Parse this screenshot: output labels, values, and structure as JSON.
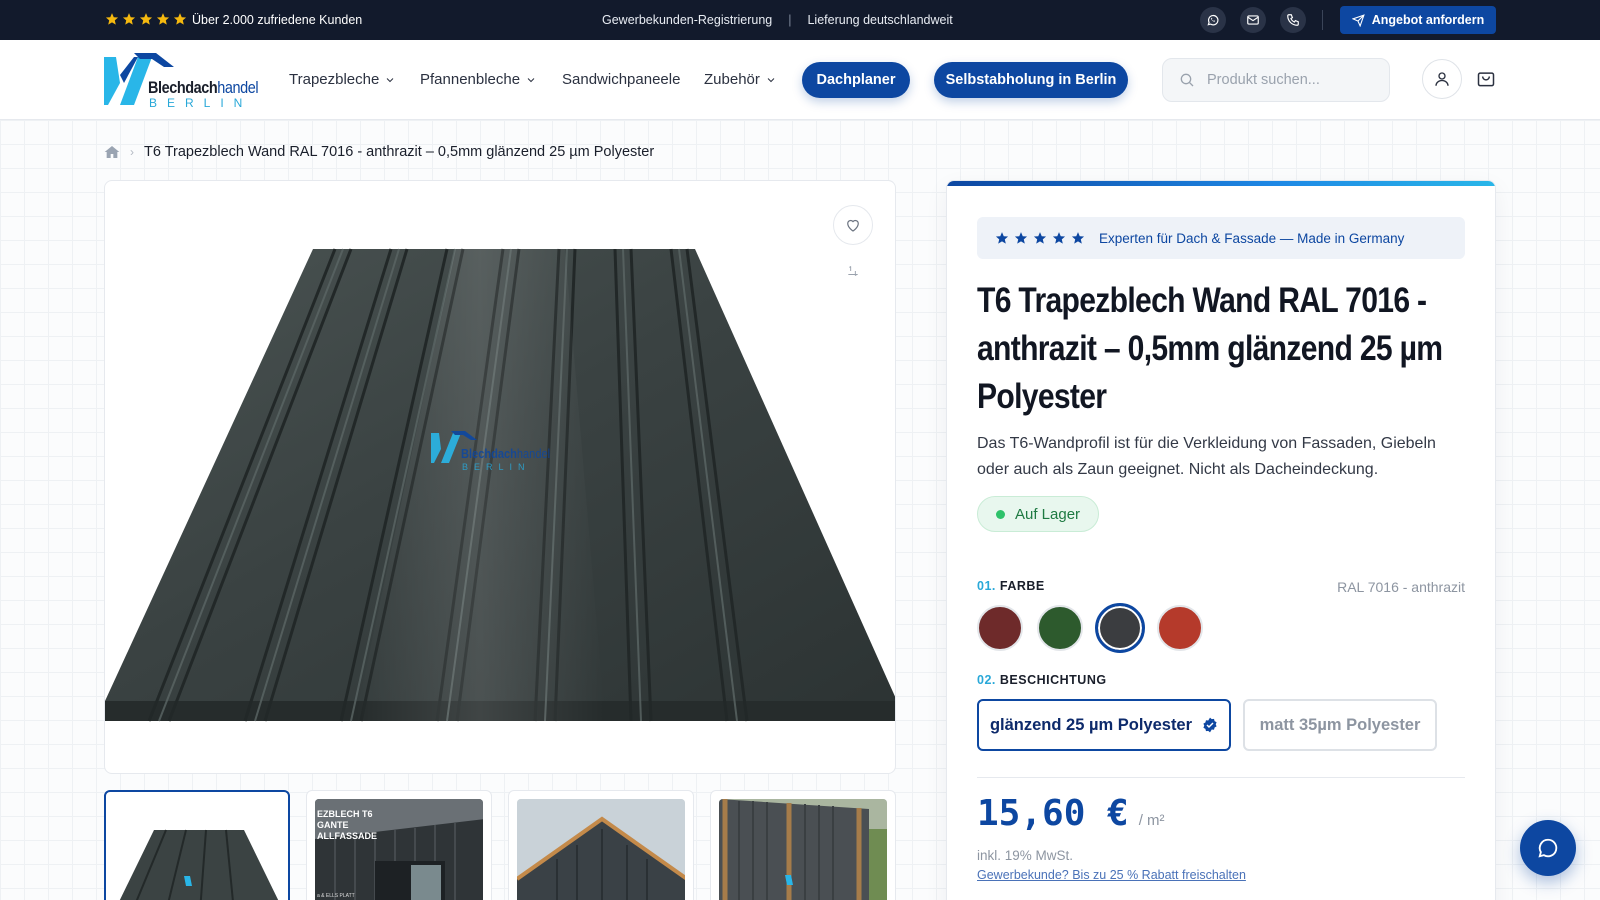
{
  "topbar": {
    "rating_text": "Über 2.000 zufriedene Kunden",
    "link_b2b": "Gewerbekunden-Registrierung",
    "separator": "|",
    "delivery": "Lieferung deutschlandweit",
    "offer_button": "Angebot anfordern",
    "icons": [
      "whatsapp-icon",
      "mail-icon",
      "phone-icon"
    ]
  },
  "header": {
    "logo_main": "Blechdach",
    "logo_accent": "handel",
    "logo_sub": "BERLIN",
    "nav": [
      {
        "label": "Trapezbleche",
        "dropdown": true
      },
      {
        "label": "Pfannenbleche",
        "dropdown": true
      },
      {
        "label": "Sandwichpaneele",
        "dropdown": false
      },
      {
        "label": "Zubehör",
        "dropdown": true
      }
    ],
    "pill_planner": "Dachplaner",
    "pill_pickup": "Selbstabholung in Berlin",
    "search_placeholder": "Produkt suchen..."
  },
  "breadcrumb": {
    "current": "T6 Trapezblech Wand RAL 7016 - anthrazit – 0,5mm glänzend 25 µm Polyester"
  },
  "gallery": {
    "watermark_main": "Blechdach",
    "watermark_accent": "handel",
    "watermark_sub": "BERLIN",
    "thumb2_text": [
      "EZBLECH T6",
      "GANTE",
      "ALLFASSADE"
    ],
    "thumb2_caption": "a & ELLS PLATT"
  },
  "product": {
    "expert_text": "Experten für Dach & Fassade — Made in Germany",
    "title": "T6 Trapezblech Wand RAL 7016 - anthrazit – 0,5mm glänzend 25 µm Polyester",
    "description": "Das T6-Wandprofil ist für die Verkleidung von Fassaden, Giebeln oder auch als Zaun geeignet. Nicht als Dacheindeckung.",
    "stock": "Auf Lager",
    "color_section": {
      "num": "01.",
      "label": "FARBE",
      "selected": "RAL 7016 - anthrazit"
    },
    "swatches": [
      "#6e2a2a",
      "#2d5a2d",
      "#3b3d40",
      "#b53a2b"
    ],
    "active_swatch_index": 2,
    "coating_section": {
      "num": "02.",
      "label": "BESCHICHTUNG"
    },
    "coatings": [
      "glänzend 25 µm Polyester",
      "matt 35µm Polyester"
    ],
    "price": "15,60 €",
    "unit": "/ m²",
    "tax": "inkl. 19% MwSt.",
    "b2b_link": "Gewerbekunde? Bis zu 25 % Rabatt freischalten"
  },
  "colors": {
    "brand": "#0d47a1",
    "topbar_bg": "#121a2c",
    "star": "#f5b90f",
    "accent_cyan": "#29a8d8"
  }
}
